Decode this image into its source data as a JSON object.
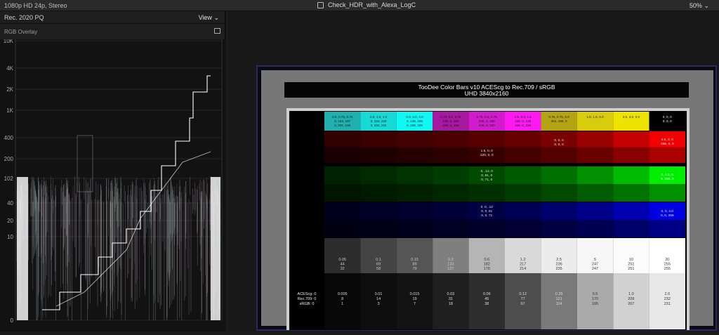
{
  "topbar": {
    "format": "1080p HD 24p, Stereo",
    "project": "Check_HDR_with_Alexa_LogC",
    "zoom": "50%",
    "zoom_caret": "⌄"
  },
  "scope": {
    "colorspace": "Rec. 2020 PQ",
    "view_label": "View",
    "view_caret": "⌄",
    "mode": "RGB Overlay",
    "ticks": [
      {
        "label": "10K",
        "nits": 10000
      },
      {
        "label": "4K",
        "nits": 4000
      },
      {
        "label": "2K",
        "nits": 2000
      },
      {
        "label": "1K",
        "nits": 1000
      },
      {
        "label": "400",
        "nits": 400
      },
      {
        "label": "200",
        "nits": 200
      },
      {
        "label": "102",
        "nits": 102
      },
      {
        "label": "40",
        "nits": 40
      },
      {
        "label": "20",
        "nits": 20
      },
      {
        "label": "10",
        "nits": 10
      },
      {
        "label": "0",
        "nits": 0
      }
    ]
  },
  "viewer": {
    "title": "TooDee Color Bars v10 ACEScg to Rec.709 / sRGB",
    "subtitle": "UHD 3840x2160",
    "top_swatches": [
      {
        "color": "#20b0b0",
        "lines": [
          "0.0, 0.75, 0.75",
          "0, 184, 187",
          "0, 201, 194"
        ]
      },
      {
        "color": "#17d9d6",
        "lines": [
          "0.0, 1.5, 1.5",
          "0, 224, 226",
          "0, 224, 224"
        ]
      },
      {
        "color": "#0ff8f4",
        "lines": [
          "0.0, 3.0, 3.0",
          "0, 136, 226",
          "0, 236, 225"
        ]
      },
      {
        "color": "#a818a0",
        "lines": [
          "0.75, 0.0, 0.75",
          "195, 0, 186",
          "200, 0, 199"
        ]
      },
      {
        "color": "#d01ccb",
        "lines": [
          "0.75, 0.0, 0.75",
          "225, 0, 185",
          "226, 0, 200"
        ]
      },
      {
        "color": "#ff1af4",
        "lines": [
          "1.5, 0.0, 1.5",
          "226, 0, 226",
          "226, 0, 226"
        ]
      },
      {
        "color": "#b4a414",
        "lines": [
          "0.75, 0.75, 0.0",
          "201, 198, 0",
          ""
        ]
      },
      {
        "color": "#d8cc0c",
        "lines": [
          "1.5, 1.5, 0.0",
          "",
          ""
        ]
      },
      {
        "color": "#eee402",
        "lines": [
          "3.0, 3.0, 0.0",
          "",
          ""
        ]
      },
      {
        "color": "#000000",
        "lines": [
          "0, 0, 0",
          "0, 0, 0",
          ""
        ]
      }
    ],
    "red_labels": [
      "0, 0, 0",
      "0, 0, 0",
      "1.5, 0, 0",
      "220, 0, 0",
      "3.0, 0, 0",
      "255, 0, 0"
    ],
    "green_labels": [
      "0, .12, 0",
      "0, 81, 0",
      "0, 71, 0",
      "0, 4.0, 0",
      "0, 255, 0"
    ],
    "blue_labels": [
      "0, 0, .12",
      "0, 0, 81",
      "0, 0, 71",
      "0, 0, 4.0",
      "0, 0, 255"
    ],
    "gray_upper": [
      {
        "lines": [
          "0.05",
          "44",
          "32"
        ]
      },
      {
        "lines": [
          "0.1",
          "69",
          "58"
        ]
      },
      {
        "lines": [
          "0.15",
          "89",
          "79"
        ]
      },
      {
        "lines": [
          "0.3",
          "133",
          "127"
        ]
      },
      {
        "lines": [
          "0.6",
          "182",
          "178"
        ]
      },
      {
        "lines": [
          "1.2",
          "217",
          "214"
        ]
      },
      {
        "lines": [
          "2.5",
          "236",
          "235"
        ]
      },
      {
        "lines": [
          "5",
          "247",
          "247"
        ]
      },
      {
        "lines": [
          "10",
          "251",
          "251"
        ]
      },
      {
        "lines": [
          "20",
          "255",
          "255"
        ]
      }
    ],
    "gray_lower": [
      {
        "lines": [
          "0.005",
          "8",
          "1"
        ]
      },
      {
        "lines": [
          "0.01",
          "14",
          "3"
        ]
      },
      {
        "lines": [
          "0.015",
          "19",
          "7"
        ]
      },
      {
        "lines": [
          "0.03",
          "31",
          "18"
        ]
      },
      {
        "lines": [
          "0.06",
          "45",
          "38"
        ]
      },
      {
        "lines": [
          "0.12",
          "77",
          "67"
        ]
      },
      {
        "lines": [
          "0.25",
          "121",
          "114"
        ]
      },
      {
        "lines": [
          "0.5",
          "170",
          "165"
        ]
      },
      {
        "lines": [
          "1.0",
          "209",
          "207"
        ]
      },
      {
        "lines": [
          "2.0",
          "232",
          "231"
        ]
      }
    ],
    "row_labels": [
      "ACEScg: 0",
      "Rec.709: 0",
      "sRGB: 0"
    ]
  }
}
